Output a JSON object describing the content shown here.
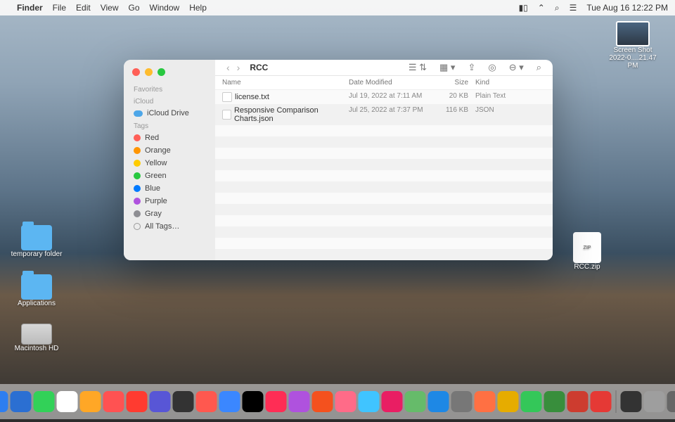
{
  "menubar": {
    "app": "Finder",
    "items": [
      "File",
      "Edit",
      "View",
      "Go",
      "Window",
      "Help"
    ],
    "datetime": "Tue Aug 16  12:22 PM"
  },
  "desktop": {
    "screenshot": "Screen Shot 2022-0....21.47 PM",
    "temp_folder": "temporary folder",
    "applications": "Applications",
    "macintosh_hd": "Macintosh HD",
    "rcc_zip": "RCC.zip"
  },
  "finder": {
    "title": "RCC",
    "sidebar": {
      "favorites": "Favorites",
      "icloud_section": "iCloud",
      "icloud_drive": "iCloud Drive",
      "tags_section": "Tags",
      "tags": [
        {
          "label": "Red",
          "color": "#ff5f57"
        },
        {
          "label": "Orange",
          "color": "#ff9500"
        },
        {
          "label": "Yellow",
          "color": "#ffcc00"
        },
        {
          "label": "Green",
          "color": "#28c840"
        },
        {
          "label": "Blue",
          "color": "#007aff"
        },
        {
          "label": "Purple",
          "color": "#af52de"
        },
        {
          "label": "Gray",
          "color": "#8e8e93"
        }
      ],
      "all_tags": "All Tags…"
    },
    "columns": {
      "name": "Name",
      "date": "Date Modified",
      "size": "Size",
      "kind": "Kind"
    },
    "files": [
      {
        "name": "license.txt",
        "date": "Jul 19, 2022 at 7:11 AM",
        "size": "20 KB",
        "kind": "Plain Text"
      },
      {
        "name": "Responsive Comparison Charts.json",
        "date": "Jul 25, 2022 at 7:37 PM",
        "size": "116 KB",
        "kind": "JSON"
      }
    ]
  },
  "dock_colors": [
    "#3b9bff",
    "#8e8e93",
    "#2d7ef0",
    "#2b6fd2",
    "#32d158",
    "#fff",
    "#ffa726",
    "#ff5252",
    "#ff3b30",
    "#5856d6",
    "#333",
    "#ff584f",
    "#3b87ff",
    "#000",
    "#ff2d55",
    "#af52de",
    "#f4511e",
    "#ff6b88",
    "#40c4ff",
    "#e91e63",
    "#66bb6a",
    "#1e88e5",
    "#777",
    "#ff7043",
    "#e6ac00",
    "#34c759",
    "#388e3c",
    "#cd3c2f",
    "#e53935",
    "#333",
    "#9e9e9e",
    "#666",
    "#ffa000",
    "#bbb"
  ]
}
